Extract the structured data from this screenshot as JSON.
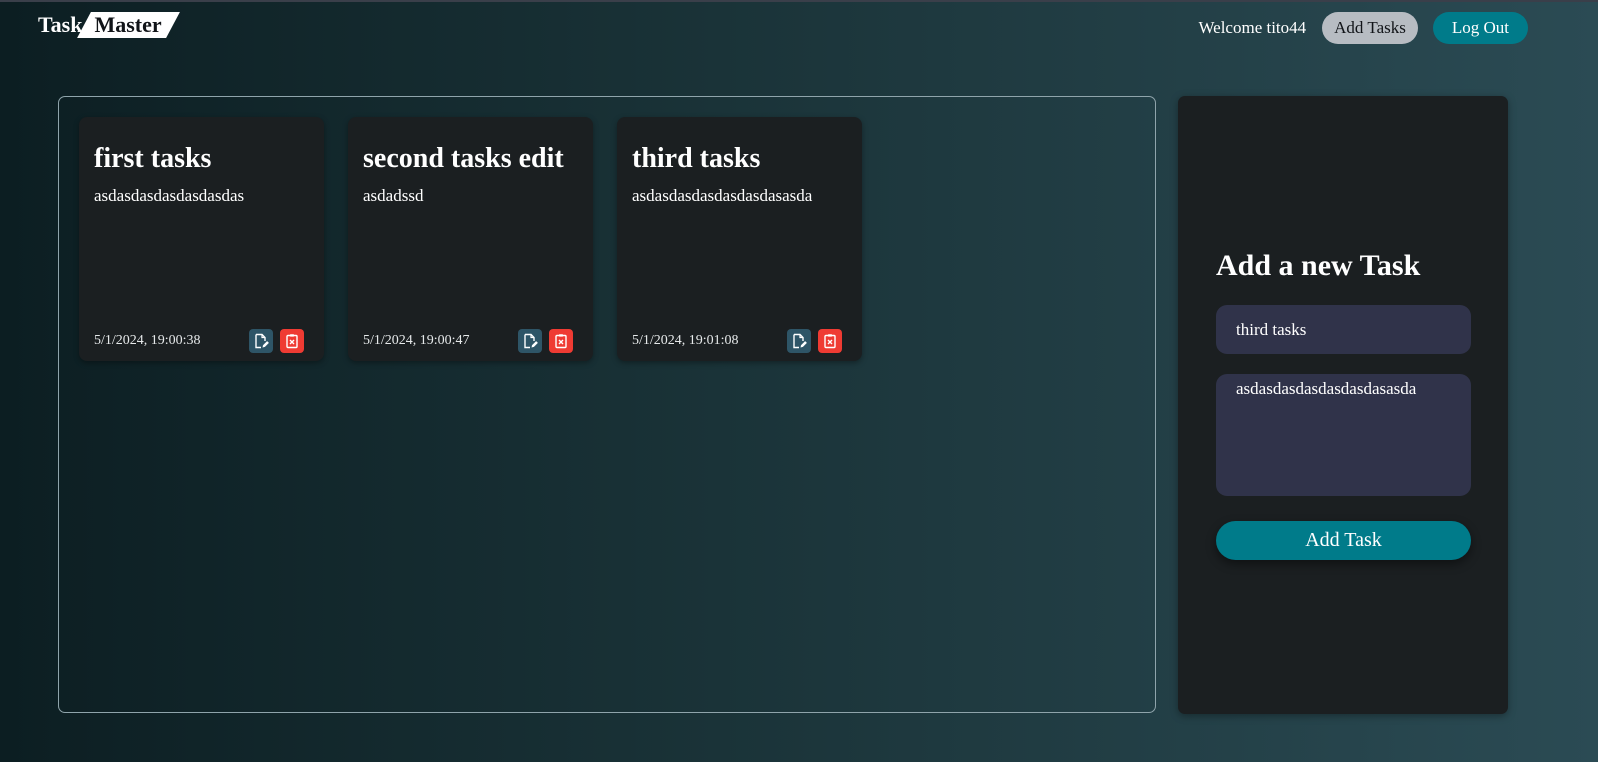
{
  "header": {
    "logo_part1": "Task",
    "logo_part2": "Master",
    "welcome_text": "Welcome tito44",
    "add_tasks_label": "Add Tasks",
    "logout_label": "Log Out"
  },
  "tasks": [
    {
      "title": "first tasks",
      "description": "asdasdasdasdasdasdas",
      "date": "5/1/2024, 19:00:38"
    },
    {
      "title": "second tasks edit",
      "description": "asdadssd",
      "date": "5/1/2024, 19:00:47"
    },
    {
      "title": "third tasks",
      "description": "asdasdasdasdasdasdasasda",
      "date": "5/1/2024, 19:01:08"
    }
  ],
  "form": {
    "heading": "Add a new Task",
    "title_value": "third tasks",
    "description_value": "asdasdasdasdasdasdasasda",
    "submit_label": "Add Task"
  },
  "colors": {
    "accent": "#007b8a",
    "edit_button": "#2e5567",
    "delete_button": "#ef3b33",
    "card_background": "#1b1f21",
    "input_background": "#30334a"
  },
  "icons": {
    "edit": "edit-document-icon",
    "delete": "delete-clipboard-icon"
  }
}
